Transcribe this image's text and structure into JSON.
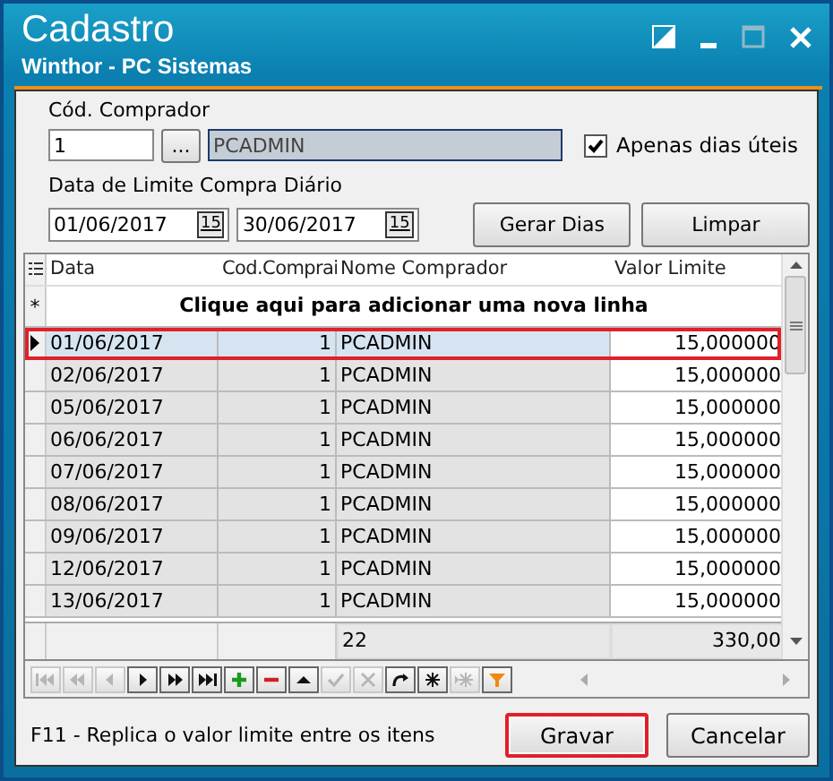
{
  "window": {
    "title": "Cadastro",
    "subtitle": "Winthor - PC Sistemas"
  },
  "comprador": {
    "label": "Cód. Comprador",
    "code": "1",
    "lookup_button": "...",
    "name": "PCADMIN"
  },
  "apenas_dias_uteis": {
    "label": "Apenas dias úteis",
    "checked": true
  },
  "periodo": {
    "label": "Data de Limite Compra Diário",
    "start": "01/06/2017",
    "end": "30/06/2017",
    "calendar_labels": [
      "15",
      "15"
    ]
  },
  "buttons_top": [
    {
      "label": "Gerar Dias"
    },
    {
      "label": "Limpar"
    }
  ],
  "table": {
    "columns": [
      "Data",
      "Cod.Comprai",
      "Nome Comprador",
      "Valor Limite"
    ],
    "new_row_text": "Clique aqui para adicionar uma nova linha",
    "new_row_marker": "*",
    "rows": [
      {
        "cells": [
          "01/06/2017",
          "1",
          "PCADMIN",
          "15,000000"
        ],
        "selected": true
      },
      {
        "cells": [
          "02/06/2017",
          "1",
          "PCADMIN",
          "15,000000"
        ],
        "selected": false
      },
      {
        "cells": [
          "05/06/2017",
          "1",
          "PCADMIN",
          "15,000000"
        ],
        "selected": false
      },
      {
        "cells": [
          "06/06/2017",
          "1",
          "PCADMIN",
          "15,000000"
        ],
        "selected": false
      },
      {
        "cells": [
          "07/06/2017",
          "1",
          "PCADMIN",
          "15,000000"
        ],
        "selected": false
      },
      {
        "cells": [
          "08/06/2017",
          "1",
          "PCADMIN",
          "15,000000"
        ],
        "selected": false
      },
      {
        "cells": [
          "09/06/2017",
          "1",
          "PCADMIN",
          "15,000000"
        ],
        "selected": false
      },
      {
        "cells": [
          "12/06/2017",
          "1",
          "PCADMIN",
          "15,000000"
        ],
        "selected": false
      },
      {
        "cells": [
          "13/06/2017",
          "1",
          "PCADMIN",
          "15,000000"
        ],
        "selected": false
      }
    ],
    "footer": [
      "22",
      "330,00"
    ]
  },
  "navigator": [
    {
      "kind": "first",
      "disabled": true
    },
    {
      "kind": "prior-page",
      "disabled": true
    },
    {
      "kind": "prior",
      "disabled": true
    },
    {
      "kind": "next",
      "disabled": false
    },
    {
      "kind": "next-page",
      "disabled": false
    },
    {
      "kind": "last",
      "disabled": false
    },
    {
      "kind": "insert",
      "disabled": false
    },
    {
      "kind": "delete",
      "disabled": false
    },
    {
      "kind": "edit",
      "disabled": false
    },
    {
      "kind": "post",
      "disabled": true
    },
    {
      "kind": "cancel",
      "disabled": true
    },
    {
      "kind": "refresh",
      "disabled": false
    },
    {
      "kind": "bookmark",
      "disabled": false
    },
    {
      "kind": "goto-bookmark",
      "disabled": true
    },
    {
      "kind": "filter",
      "disabled": false
    }
  ],
  "hint": "F11 - Replica o valor limite entre os itens",
  "buttons_bottom": [
    {
      "label": "Gravar",
      "highlighted": true
    },
    {
      "label": "Cancelar",
      "highlighted": false
    }
  ]
}
